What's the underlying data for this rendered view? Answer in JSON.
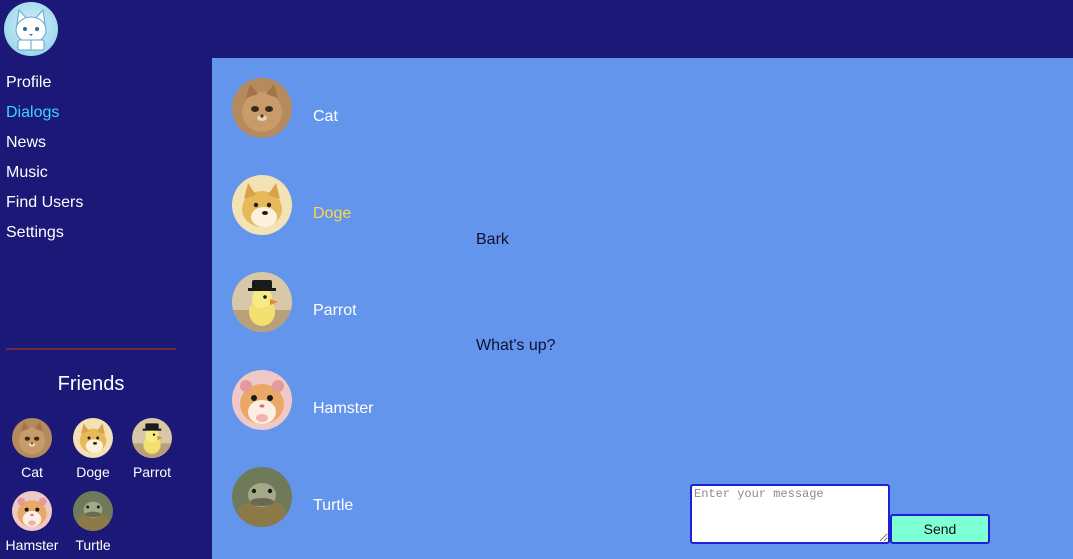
{
  "colors": {
    "header_bg": "#1b1878",
    "sidebar_bg": "#1b1878",
    "content_bg": "#6495ed",
    "active_nav": "#3fd3ff",
    "active_dialog": "#ffd54a",
    "send_button_bg": "#7fffd4",
    "border_accent": "#1f1fd6"
  },
  "header": {
    "logo_icon": "cat-face-icon"
  },
  "sidebar": {
    "nav": [
      {
        "label": "Profile"
      },
      {
        "label": "Dialogs",
        "active": true
      },
      {
        "label": "News"
      },
      {
        "label": "Music"
      },
      {
        "label": "Find Users"
      },
      {
        "label": "Settings"
      }
    ],
    "friends_title": "Friends",
    "friends": [
      {
        "name": "Cat",
        "icon": "cat-avatar-icon"
      },
      {
        "name": "Doge",
        "icon": "doge-avatar-icon"
      },
      {
        "name": "Parrot",
        "icon": "parrot-avatar-icon"
      },
      {
        "name": "Hamster",
        "icon": "hamster-avatar-icon"
      },
      {
        "name": "Turtle",
        "icon": "turtle-avatar-icon"
      }
    ]
  },
  "dialogs": [
    {
      "name": "Cat",
      "icon": "cat-avatar-icon"
    },
    {
      "name": "Doge",
      "icon": "doge-avatar-icon",
      "active": true
    },
    {
      "name": "Parrot",
      "icon": "parrot-avatar-icon"
    },
    {
      "name": "Hamster",
      "icon": "hamster-avatar-icon"
    },
    {
      "name": "Turtle",
      "icon": "turtle-avatar-icon"
    }
  ],
  "messages": [
    {
      "text": "Bark"
    },
    {
      "text": "What's up?"
    }
  ],
  "composer": {
    "placeholder": "Enter your message",
    "value": "",
    "send_label": "Send"
  }
}
